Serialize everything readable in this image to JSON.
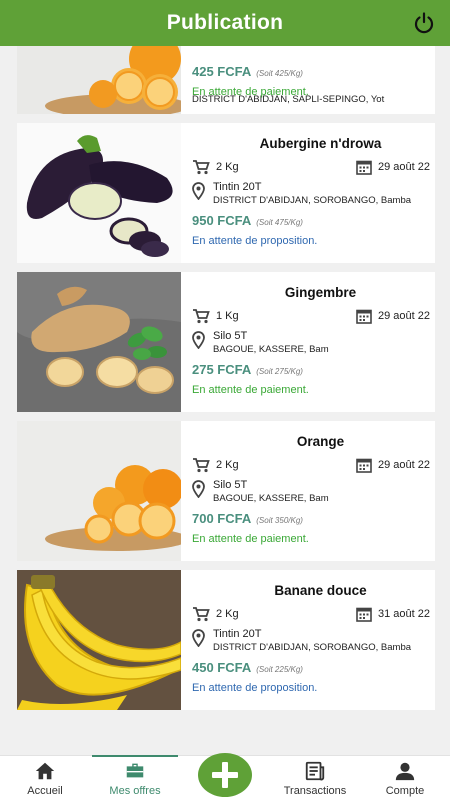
{
  "header": {
    "title": "Publication"
  },
  "cards": [
    {
      "name": "",
      "qty": "",
      "date": "",
      "location_name": "",
      "location_addr": "DISTRICT D'ABIDJAN, SAPLI-SEPINGO, Yot",
      "price": "425 FCFA",
      "unit_price": "(Soit 425/Kg)",
      "status": "En attente de paiement.",
      "status_color": "#3aa836"
    },
    {
      "name": "Aubergine n'drowa",
      "qty": "2 Kg",
      "date": "29 août 22",
      "location_name": "Tintin 20T",
      "location_addr": "DISTRICT D'ABIDJAN, SOROBANGO, Bamba",
      "price": "950 FCFA",
      "unit_price": "(Soit 475/Kg)",
      "status": "En attente de proposition.",
      "status_color": "#2f68b0"
    },
    {
      "name": "Gingembre",
      "qty": "1 Kg",
      "date": "29 août 22",
      "location_name": "Silo 5T",
      "location_addr": "BAGOUE, KASSERE, Bam",
      "price": "275 FCFA",
      "unit_price": "(Soit 275/Kg)",
      "status": "En attente de paiement.",
      "status_color": "#3aa836"
    },
    {
      "name": "Orange",
      "qty": "2 Kg",
      "date": "29 août 22",
      "location_name": "Silo 5T",
      "location_addr": "BAGOUE, KASSERE, Bam",
      "price": "700 FCFA",
      "unit_price": "(Soit 350/Kg)",
      "status": "En attente de paiement.",
      "status_color": "#3aa836"
    },
    {
      "name": "Banane douce",
      "qty": "2 Kg",
      "date": "31 août 22",
      "location_name": "Tintin 20T",
      "location_addr": "DISTRICT D'ABIDJAN, SOROBANGO, Bamba",
      "price": "450 FCFA",
      "unit_price": "(Soit 225/Kg)",
      "status": "En attente de proposition.",
      "status_color": "#2f68b0"
    }
  ],
  "nav": {
    "home": "Accueil",
    "offers": "Mes offres",
    "transactions": "Transactions",
    "account": "Compte"
  },
  "colors": {
    "brand": "#5fa137",
    "price": "#4a8f7e",
    "accent": "#3e8a6d"
  }
}
